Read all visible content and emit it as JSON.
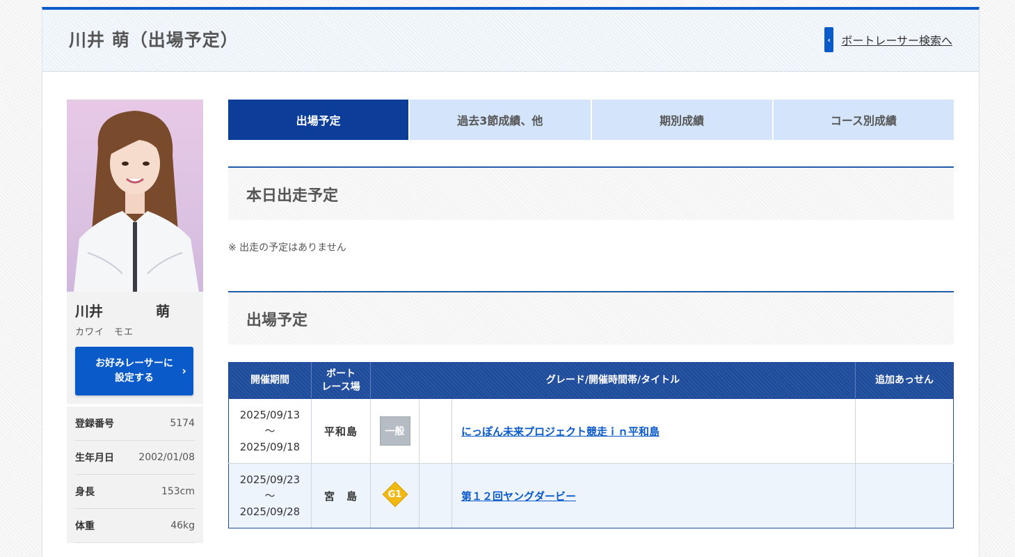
{
  "header": {
    "title": "川井 萌（出場予定）",
    "back_chevron": "‹",
    "back_link": "ボートレーサー検索へ"
  },
  "profile": {
    "family_name": "川井",
    "given_name": "萌",
    "kana": "カワイ　モエ",
    "fav_button_line1": "お好みレーサーに",
    "fav_button_line2": "設定する",
    "fav_chevron": "›",
    "info": [
      {
        "label": "登録番号",
        "value": "5174"
      },
      {
        "label": "生年月日",
        "value": "2002/01/08"
      },
      {
        "label": "身長",
        "value": "153cm"
      },
      {
        "label": "体重",
        "value": "46kg"
      }
    ]
  },
  "tabs": [
    {
      "label": "出場予定",
      "active": true
    },
    {
      "label": "過去3節成績、他",
      "active": false
    },
    {
      "label": "期別成績",
      "active": false
    },
    {
      "label": "コース別成績",
      "active": false
    }
  ],
  "today": {
    "title": "本日出走予定",
    "note": "※ 出走の予定はありません"
  },
  "schedule": {
    "title": "出場予定",
    "headers": {
      "period": "開催期間",
      "venue_line1": "ボート",
      "venue_line2": "レース場",
      "grade_title": "グレード/開催時間帯/タイトル",
      "extra": "追加あっせん"
    },
    "rows": [
      {
        "date_from": "2025/09/13",
        "tilde": "～",
        "date_to": "2025/09/18",
        "venue": "平和島",
        "grade": "一般",
        "time_slot": "",
        "title": "にっぽん未来プロジェクト競走ｉｎ平和島",
        "extra": ""
      },
      {
        "date_from": "2025/09/23",
        "tilde": "～",
        "date_to": "2025/09/28",
        "venue": "宮　島",
        "grade": "G1",
        "time_slot": "",
        "title": "第１２回ヤングダービー",
        "extra": ""
      }
    ]
  },
  "colors": {
    "accent": "#0a5ac9",
    "tab_active": "#0b3d99",
    "tab_inactive": "#d4e5fb",
    "table_header": "#1d4a9b",
    "grade_g1": "#f0b913",
    "grade_ippan": "#b5bcc4"
  }
}
